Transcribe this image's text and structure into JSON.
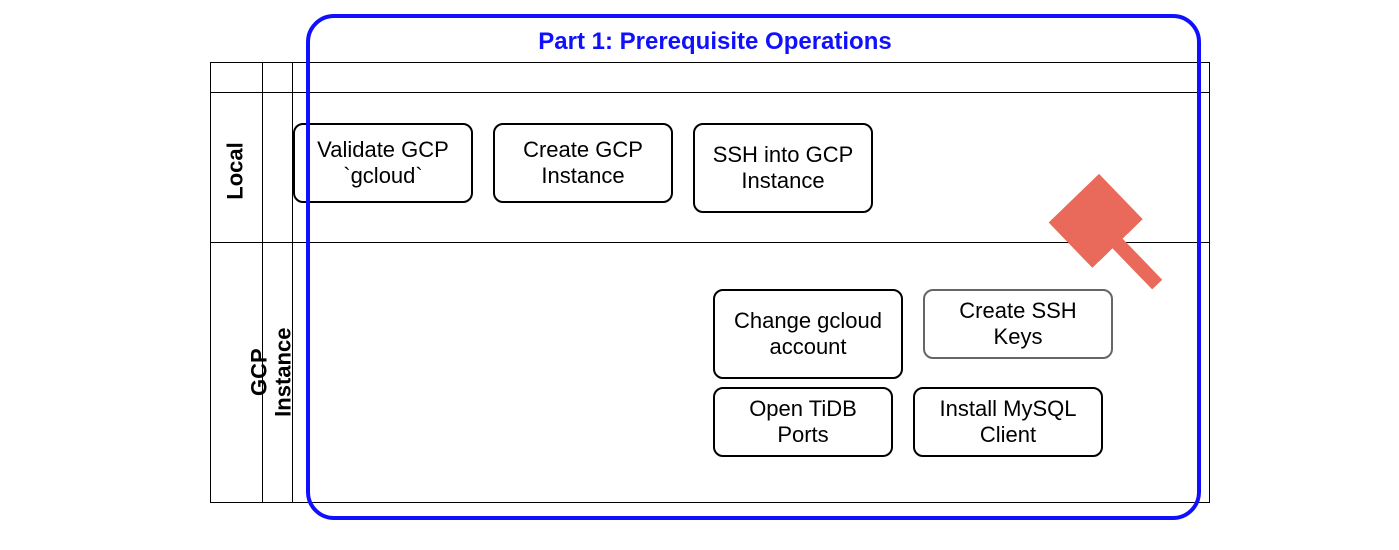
{
  "title": "Part 1: Prerequisite Operations",
  "lanes": {
    "local": "Local",
    "gcp": "GCP\nInstance"
  },
  "steps": {
    "validate_gcp": "Validate GCP `gcloud`",
    "create_gcp": "Create GCP Instance",
    "ssh_gcp": "SSH into GCP Instance",
    "change_account": "Change gcloud account",
    "create_ssh": "Create SSH Keys",
    "open_ports": "Open TiDB Ports",
    "install_mysql": "Install MySQL Client"
  },
  "colors": {
    "accent": "#1010ff",
    "arrow": "#e96a5a"
  }
}
